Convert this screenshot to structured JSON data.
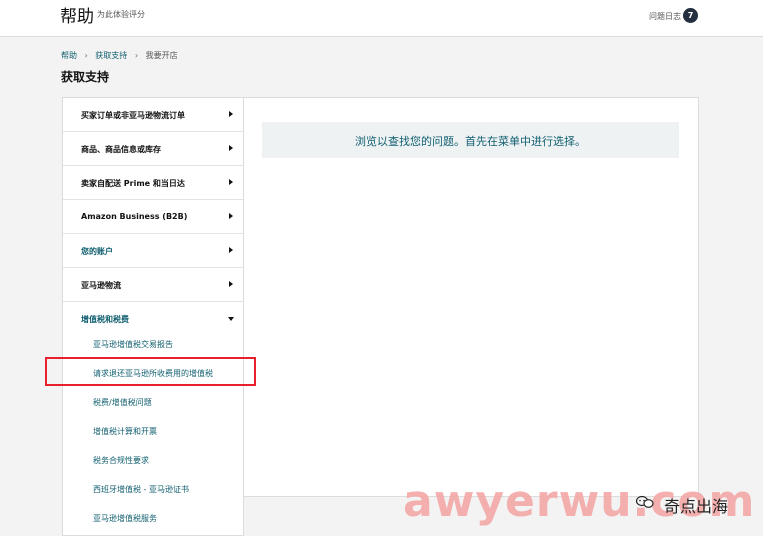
{
  "header": {
    "title": "帮助",
    "subtitle": "为此体验评分",
    "log_label": "问题日志",
    "log_count": "7"
  },
  "breadcrumb": [
    "帮助",
    "获取支持",
    "我要开店"
  ],
  "page_title": "获取支持",
  "sidebar": {
    "items": [
      {
        "label": "买家订单或非亚马逊物流订单"
      },
      {
        "label": "商品、商品信息或库存"
      },
      {
        "label": "卖家自配送 Prime 和当日达"
      },
      {
        "label": "Amazon Business (B2B)"
      },
      {
        "label": "您的账户"
      },
      {
        "label": "亚马逊物流"
      },
      {
        "label": "增值税和税费",
        "expanded": true
      }
    ],
    "subitems": [
      "亚马逊增值税交易报告",
      "请求退还亚马逊所收费用的增值税",
      "税费/增值税问题",
      "增值税计算和开票",
      "税务合规性要求",
      "西班牙增值税 - 亚马逊证书",
      "亚马逊增值税服务"
    ],
    "highlighted_subitem": "请求退还亚马逊所收费用的增值税"
  },
  "main": {
    "message": "浏览以查找您的问题。首先在菜单中进行选择。"
  },
  "watermark": {
    "text": "awyerwu.com",
    "brand": "奇点出海"
  },
  "colors": {
    "accent": "#0f5e6f",
    "badge": "#232f3e",
    "highlight": "#e8202a",
    "watermark": "#f4a7a7"
  }
}
